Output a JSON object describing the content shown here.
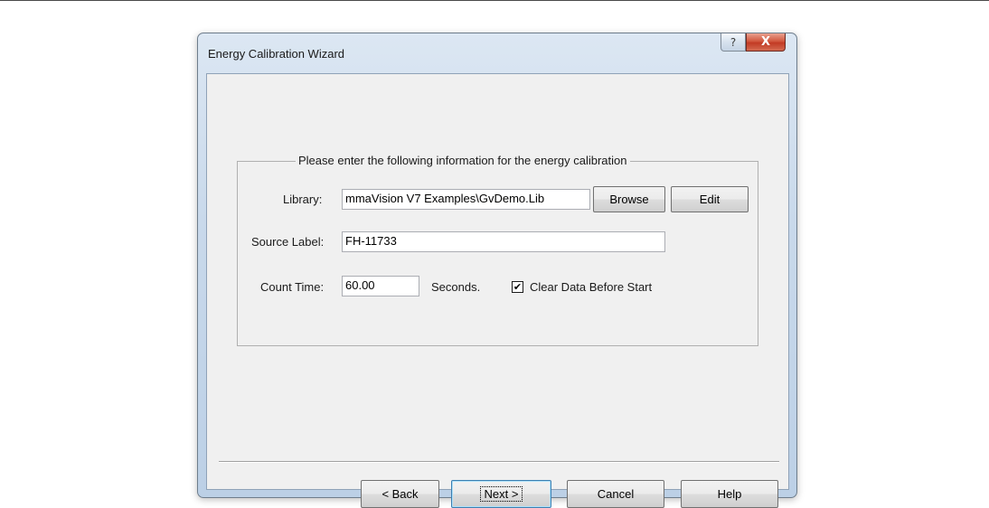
{
  "window": {
    "title": "Energy Calibration Wizard",
    "help_glyph": "?",
    "close_glyph": "X"
  },
  "group": {
    "legend": "Please enter the following information for the energy calibration"
  },
  "library": {
    "label": "Library:",
    "value": "mmaVision V7 Examples\\GvDemo.Lib",
    "browse_label": "Browse",
    "edit_label": "Edit"
  },
  "source": {
    "label": "Source Label:",
    "value": "FH-11733"
  },
  "count": {
    "label": "Count Time:",
    "value": "60.00",
    "units": "Seconds.",
    "clear_label": "Clear Data Before Start",
    "clear_checked": true,
    "check_glyph": "✔"
  },
  "footer": {
    "back_label": "< Back",
    "next_label": "Next >",
    "cancel_label": "Cancel",
    "help_label": "Help"
  },
  "colors": {
    "titlebar_accent": "#c9d9eb",
    "close_button": "#c23a24",
    "dialog_face": "#f0f0f0"
  }
}
